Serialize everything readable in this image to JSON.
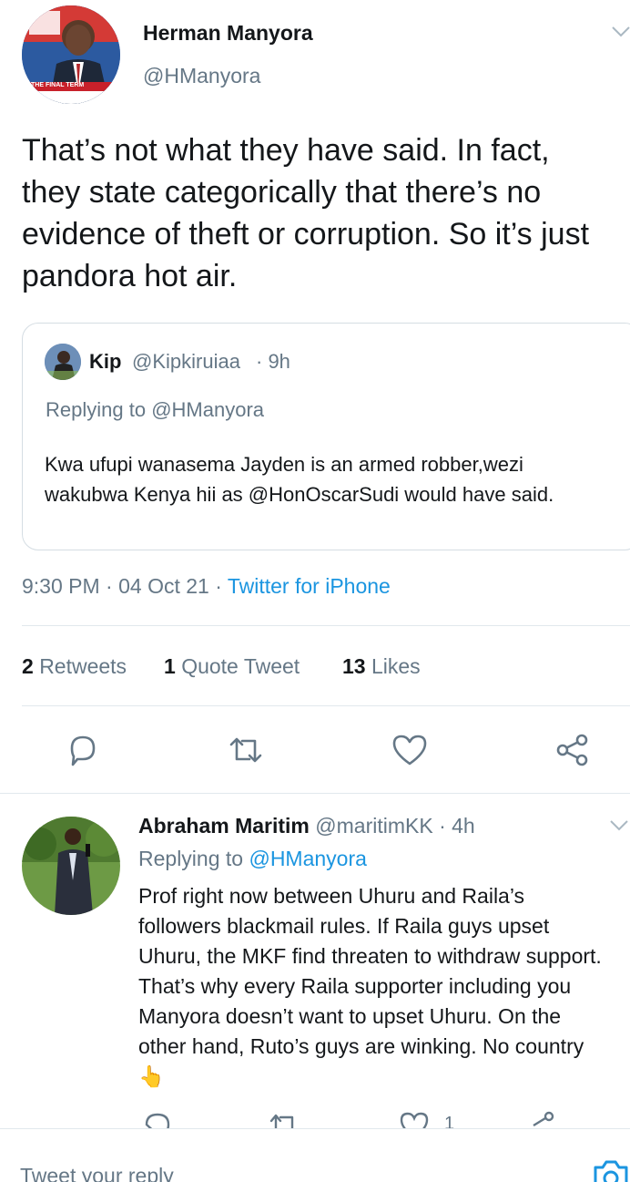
{
  "tweet": {
    "author_name": "Herman Manyora",
    "author_handle": "@HManyora",
    "avatar_caption": "THE FINAL TERM",
    "text": "That’s not what they have said. In fact, they state categorically that there’s no evidence of theft or corruption. So it’s just pandora hot air.",
    "quoted": {
      "name": "Kip",
      "handle": "@Kipkiruiaa",
      "time": "· 9h",
      "replying_prefix": "Replying to",
      "replying_handle": "@HManyora",
      "text": "Kwa ufupi wanasema Jayden is an armed robber,wezi wakubwa Kenya hii as @HonOscarSudi would have said."
    },
    "timestamp": "9:30 PM · 04 Oct 21 ·",
    "source": "Twitter for iPhone",
    "stats": [
      {
        "count": "2",
        "label": "Retweets"
      },
      {
        "count": "1",
        "label": "Quote Tweet"
      },
      {
        "count": "13",
        "label": "Likes"
      }
    ]
  },
  "reply": {
    "name": "Abraham Maritim",
    "handle": "@maritimKK",
    "time": "· 4h",
    "replying_prefix": "Replying to",
    "replying_handle": "@HManyora",
    "text": "Prof right now between Uhuru and Raila’s followers blackmail rules. If Raila guys upset Uhuru, the MKF find threaten to withdraw support. That’s why every Raila supporter including you Manyora doesn’t want to upset Uhuru. On the other hand, Ruto’s guys are winking. No country",
    "emoji": "👆",
    "like_count": "1"
  },
  "composer": {
    "placeholder": "Tweet your reply"
  },
  "icons": {
    "reply": "reply-icon",
    "retweet": "retweet-icon",
    "like": "heart-icon",
    "share": "share-icon",
    "camera": "camera-icon",
    "caret": "chevron-down-icon"
  },
  "colors": {
    "link": "#1b95e0",
    "secondary": "#657786",
    "divider": "#e1e8ed"
  }
}
